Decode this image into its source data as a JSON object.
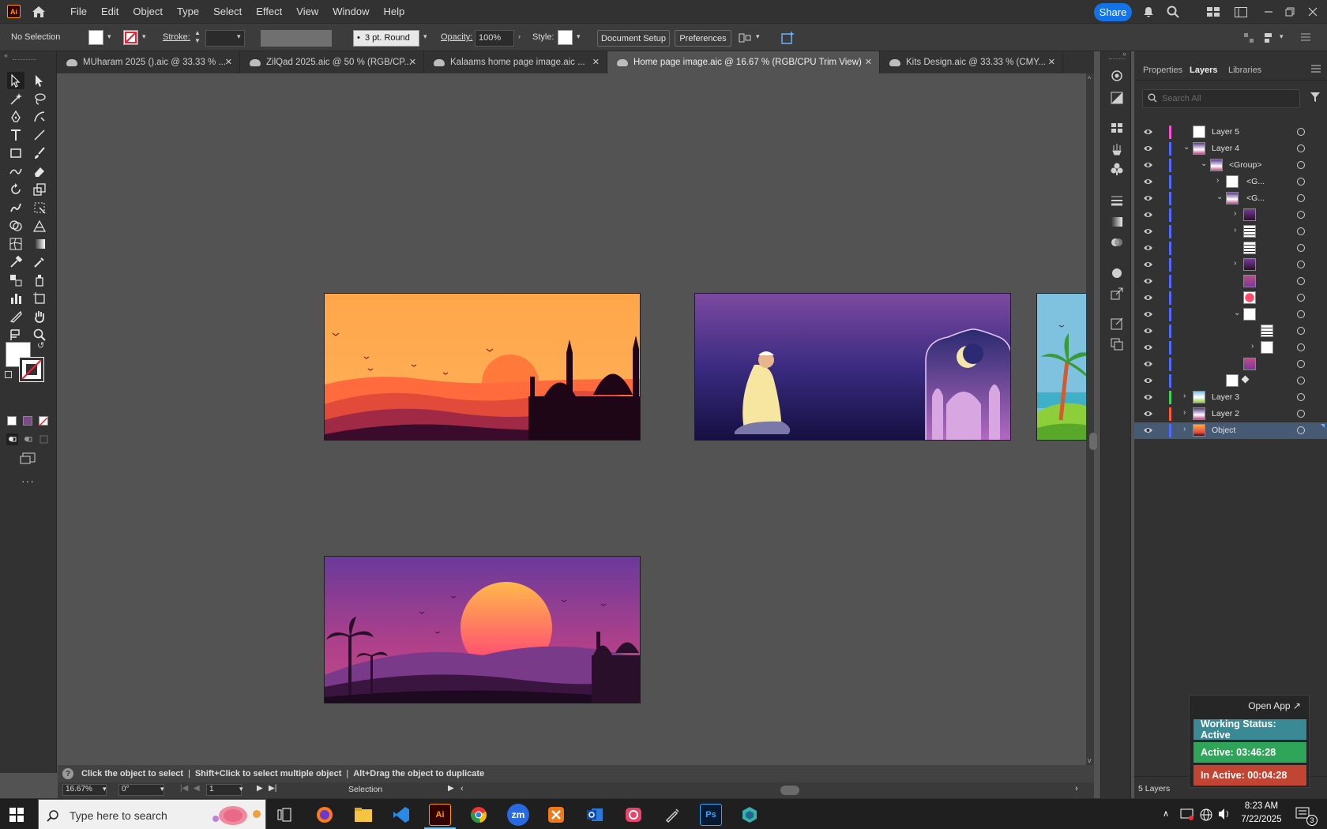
{
  "app": {
    "logo": "Ai"
  },
  "menu": [
    "File",
    "Edit",
    "Object",
    "Type",
    "Select",
    "Effect",
    "View",
    "Window",
    "Help"
  ],
  "share_label": "Share",
  "control": {
    "selection": "No Selection",
    "stroke_label": "Stroke:",
    "brush": "3 pt. Round",
    "opacity_label": "Opacity:",
    "opacity_value": "100%",
    "style_label": "Style:",
    "doc_setup": "Document Setup",
    "preferences": "Preferences"
  },
  "tabs": [
    {
      "label": "MUharam 2025 ().aic @ 33.33 % ...",
      "active": false
    },
    {
      "label": "ZilQad 2025.aic @ 50 % (RGB/CP...",
      "active": false
    },
    {
      "label": "Kalaams home page image.aic ...",
      "active": false
    },
    {
      "label": "Home page image.aic @ 16.67 % (RGB/CPU Trim View)",
      "active": true
    },
    {
      "label": "Kits Design.aic @ 33.33 % (CMY...",
      "active": false
    }
  ],
  "tip": {
    "t1": "Click the object to select",
    "sep": "|",
    "t2": "Shift+Click to select multiple object",
    "t3": "Alt+Drag the object to duplicate"
  },
  "status": {
    "zoom": "16.67%",
    "rotation": "0°",
    "artboard": "1",
    "tool": "Selection"
  },
  "panel": {
    "tabs": [
      "Properties",
      "Layers",
      "Libraries"
    ],
    "search_placeholder": "Search All",
    "layers_count": "5 Layers"
  },
  "layers": [
    {
      "name": "Layer 5",
      "color": "#ff4fd8"
    },
    {
      "name": "Layer 4",
      "color": "#4f6bff"
    },
    {
      "name": "<Group>",
      "color": "#4f6bff"
    },
    {
      "name": "<G...",
      "color": "#4f6bff"
    },
    {
      "name": "<G...",
      "color": "#4f6bff"
    },
    {
      "name": "",
      "color": "#4f6bff"
    },
    {
      "name": "",
      "color": "#4f6bff"
    },
    {
      "name": "",
      "color": "#4f6bff"
    },
    {
      "name": "",
      "color": "#4f6bff"
    },
    {
      "name": "",
      "color": "#4f6bff"
    },
    {
      "name": "",
      "color": "#4f6bff"
    },
    {
      "name": "",
      "color": "#4f6bff"
    },
    {
      "name": "",
      "color": "#4f6bff"
    },
    {
      "name": "",
      "color": "#4f6bff"
    },
    {
      "name": "",
      "color": "#4f6bff"
    },
    {
      "name": "",
      "color": "#4f6bff"
    },
    {
      "name": "Layer 3",
      "color": "#3fd34f"
    },
    {
      "name": "Layer 2",
      "color": "#ff5a3c"
    },
    {
      "name": "Object",
      "color": "#4f6bff",
      "selected": true
    }
  ],
  "widget": {
    "open_app": "Open App ↗",
    "working_status": "Working Status: Active",
    "active_time": "Active: 03:46:28",
    "inactive_time": "In Active: 00:04:28"
  },
  "taskbar": {
    "search_placeholder": "Type here to search",
    "time": "8:23 AM",
    "date": "7/22/2025",
    "notif_count": "3",
    "apps": [
      "zm",
      "Ps"
    ]
  }
}
